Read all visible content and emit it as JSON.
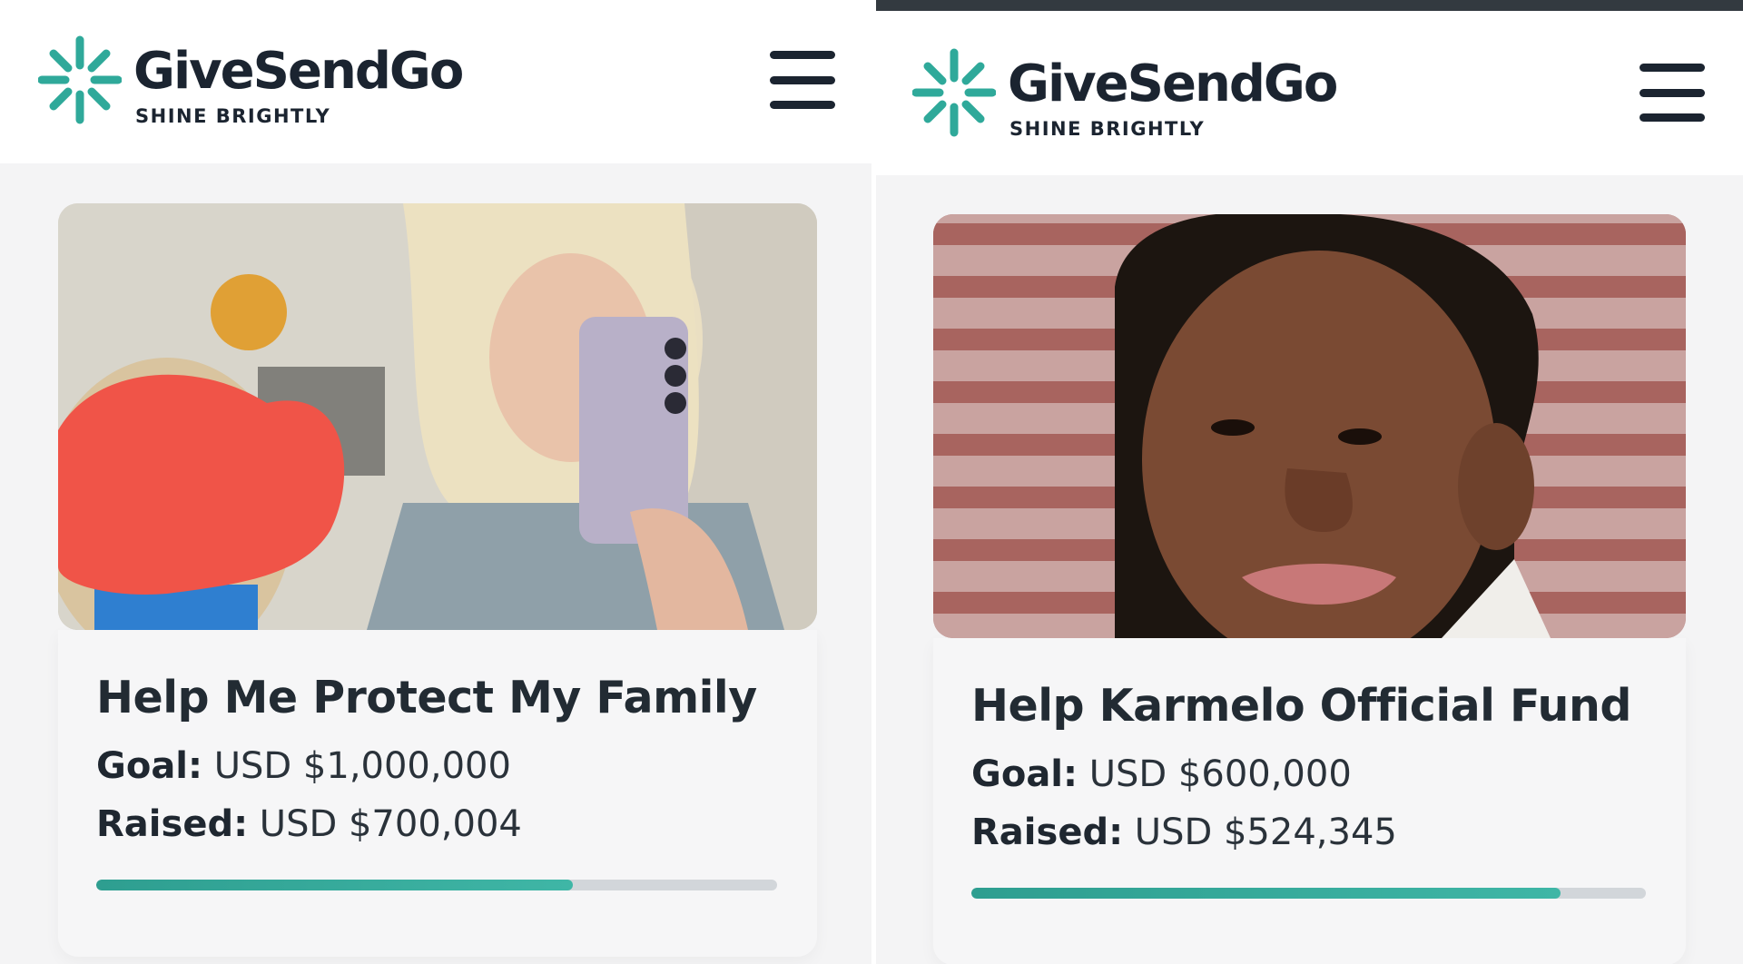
{
  "brand": {
    "name": "GiveSendGo",
    "tagline": "SHINE BRIGHTLY",
    "accent_color": "#2fa99a"
  },
  "campaigns": [
    {
      "title": "Help Me Protect My Family",
      "goal_label": "Goal:",
      "goal_value": "USD $1,000,000",
      "raised_label": "Raised:",
      "raised_value": "USD $700,004",
      "progress_fraction": 0.7
    },
    {
      "title": "Help Karmelo Official Fund",
      "goal_label": "Goal:",
      "goal_value": "USD $600,000",
      "raised_label": "Raised:",
      "raised_value": "USD $524,345",
      "progress_fraction": 0.874
    }
  ],
  "icons": {
    "logo": "sparkle-logo-icon",
    "menu": "hamburger-menu-icon"
  }
}
